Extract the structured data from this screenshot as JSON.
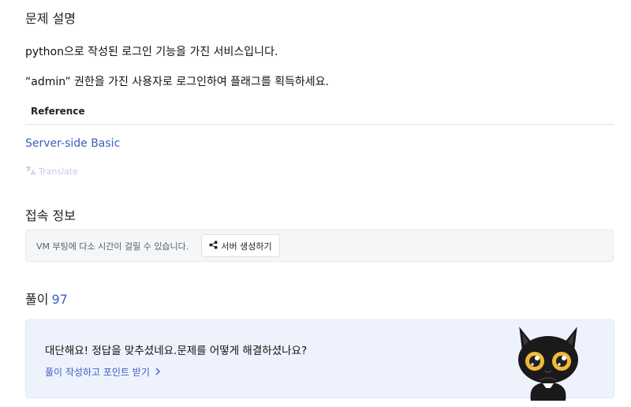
{
  "problem": {
    "heading": "문제 설명",
    "line1": "python으로 작성된 로그인 기능을 가진 서비스입니다.",
    "line2": "“admin” 권한을 가진 사용자로 로그인하여 플래그를 획득하세요."
  },
  "reference": {
    "heading": "Reference",
    "link": "Server-side Basic"
  },
  "translate": {
    "label": "Translate",
    "icon": "translate-icon"
  },
  "access": {
    "heading": "접속 정보",
    "vm_notice": "VM 부팅에 다소 시간이 걸릴 수 있습니다.",
    "create_server_button": "서버 생성하기",
    "button_icon": "share-icon"
  },
  "solves": {
    "heading": "풀이",
    "count": "97"
  },
  "card": {
    "message": "대단해요! 정답을 맞추셨네요.문제를 어떻게 해결하셨나요?",
    "link": "풀이 작성하고 포인트 받기",
    "link_icon": "chevron-right-icon",
    "mascot": "black-cat-mascot"
  },
  "colors": {
    "accent": "#3c5fbf",
    "card_bg": "#eef2fc",
    "vm_bg": "#f5f6f7"
  }
}
